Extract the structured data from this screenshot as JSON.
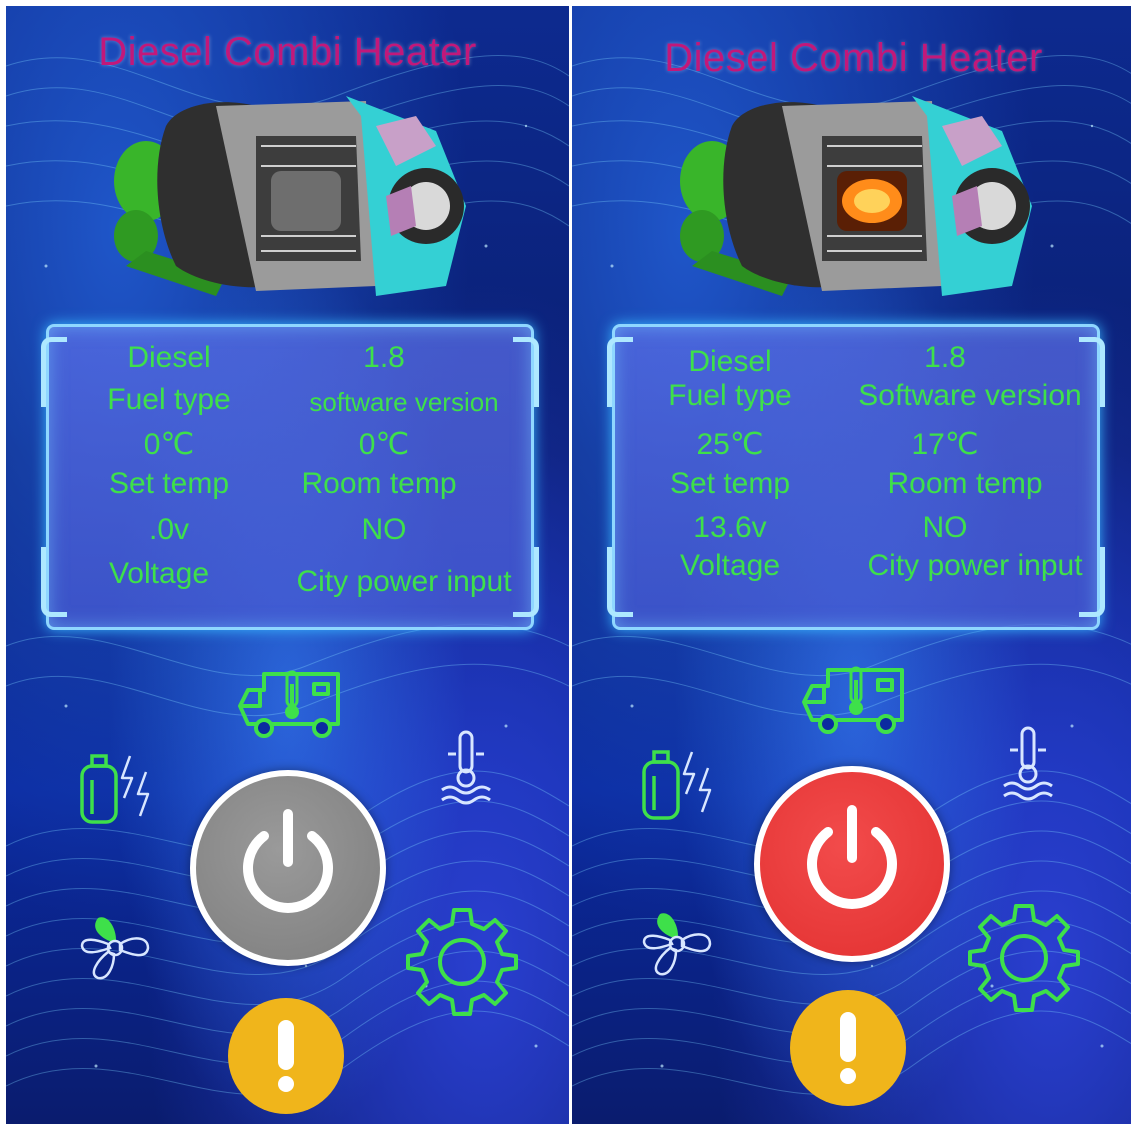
{
  "colors": {
    "title": "#c2187a",
    "value_text": "#3ee04a",
    "power_off": "#808080",
    "power_on": "#e23030",
    "alert": "#f0b51b",
    "icon_green": "#3ee04a"
  },
  "left_screen": {
    "title": "Diesel Combi Heater",
    "state": "off",
    "fuel_type_value": "Diesel",
    "fuel_type_label": "Fuel type",
    "software_version_value": "1.8",
    "software_version_label": "software version",
    "set_temp_value": "0℃",
    "set_temp_label": "Set temp",
    "room_temp_value": "0℃",
    "room_temp_label": "Room temp",
    "voltage_value": ".0v",
    "voltage_label": "Voltage",
    "city_power_value": "NO",
    "city_power_label": "City power input"
  },
  "right_screen": {
    "title": "Diesel Combi Heater",
    "state": "on",
    "fuel_type_value": "Diesel",
    "fuel_type_label": "Fuel type",
    "software_version_value": "1.8",
    "software_version_label": "Software version",
    "set_temp_value": "25℃",
    "set_temp_label": "Set temp",
    "room_temp_value": "17℃",
    "room_temp_label": "Room temp",
    "voltage_value": "13.6v",
    "voltage_label": "Voltage",
    "city_power_value": "NO",
    "city_power_label": "City power input"
  },
  "icons": [
    "camper-temperature-icon",
    "gas-electric-icon",
    "water-temperature-icon",
    "power-icon",
    "fan-icon",
    "settings-gear-icon",
    "alert-icon"
  ]
}
